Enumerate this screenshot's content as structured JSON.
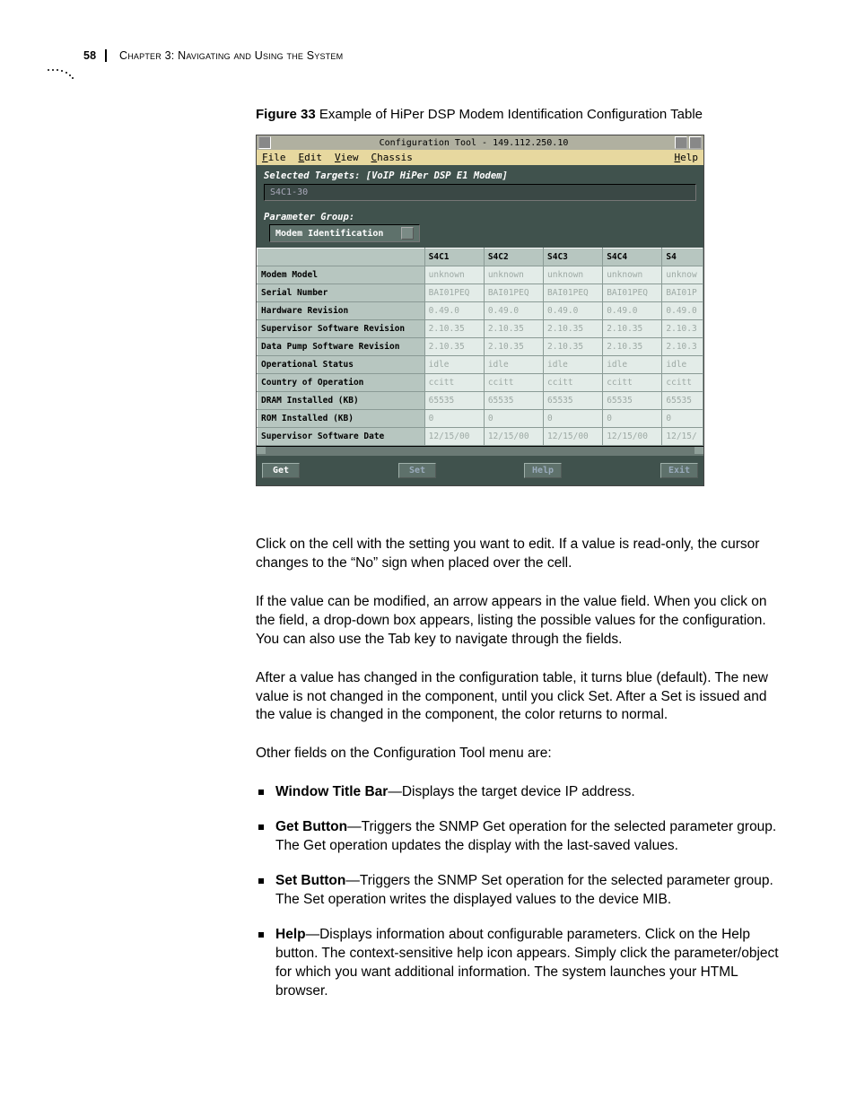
{
  "header": {
    "page_number": "58",
    "chapter_text": "Chapter 3: Navigating and Using the System"
  },
  "figure": {
    "label": "Figure 33",
    "caption": "  Example of HiPer DSP Modem Identification Configuration Table"
  },
  "window": {
    "title": "Configuration Tool - 149.112.250.10",
    "menu": {
      "file": "File",
      "edit": "Edit",
      "view": "View",
      "chassis": "Chassis",
      "help": "Help"
    },
    "selected_targets_label": "Selected Targets:  [VoIP HiPer DSP E1 Modem]",
    "target_value": "S4C1-30",
    "param_group_label": "Parameter Group:",
    "param_group_value": "Modem Identification",
    "columns": [
      "S4C1",
      "S4C2",
      "S4C3",
      "S4C4",
      "S4"
    ],
    "rows": [
      {
        "label": "Modem Model",
        "vals": [
          "unknown",
          "unknown",
          "unknown",
          "unknown",
          "unknow"
        ]
      },
      {
        "label": "Serial Number",
        "vals": [
          "BAI01PEQ",
          "BAI01PEQ",
          "BAI01PEQ",
          "BAI01PEQ",
          "BAI01P"
        ]
      },
      {
        "label": "Hardware Revision",
        "vals": [
          "0.49.0",
          "0.49.0",
          "0.49.0",
          "0.49.0",
          "0.49.0"
        ]
      },
      {
        "label": "Supervisor Software Revision",
        "vals": [
          "2.10.35",
          "2.10.35",
          "2.10.35",
          "2.10.35",
          "2.10.3"
        ]
      },
      {
        "label": "Data Pump Software Revision",
        "vals": [
          "2.10.35",
          "2.10.35",
          "2.10.35",
          "2.10.35",
          "2.10.3"
        ]
      },
      {
        "label": "Operational Status",
        "vals": [
          "idle",
          "idle",
          "idle",
          "idle",
          "idle"
        ]
      },
      {
        "label": "Country of Operation",
        "vals": [
          "ccitt",
          "ccitt",
          "ccitt",
          "ccitt",
          "ccitt"
        ]
      },
      {
        "label": "DRAM Installed (KB)",
        "vals": [
          "65535",
          "65535",
          "65535",
          "65535",
          "65535"
        ]
      },
      {
        "label": "ROM Installed (KB)",
        "vals": [
          "0",
          "0",
          "0",
          "0",
          "0"
        ]
      },
      {
        "label": "Supervisor Software Date",
        "vals": [
          "12/15/00",
          "12/15/00",
          "12/15/00",
          "12/15/00",
          "12/15/"
        ]
      }
    ],
    "buttons": {
      "get": "Get",
      "set": "Set",
      "help": "Help",
      "exit": "Exit"
    }
  },
  "body": {
    "p1": "Click on the cell with the setting you want to edit. If a value is read-only, the cursor changes to the “No” sign when placed over the cell.",
    "p2": "If the value can be modified, an arrow appears in the value field. When you click on the field, a drop-down box appears, listing the possible values for the configuration. You can also use the Tab key to navigate through the fields.",
    "p3": "After a value has changed in the configuration table, it turns blue (default). The new value is not changed in the component, until you click Set. After a Set is issued and the value is changed in the component, the color returns to normal.",
    "p4": "Other fields on the Configuration Tool menu are:",
    "bullets": [
      {
        "term": "Window Title Bar",
        "rest": "—Displays the target device IP address."
      },
      {
        "term": "Get Button",
        "rest": "—Triggers the SNMP Get operation for the selected parameter group. The Get operation updates the display with the last-saved values."
      },
      {
        "term": "Set Button",
        "rest": "—Triggers the SNMP Set operation for the selected parameter group. The Set operation writes the displayed values to the device MIB."
      },
      {
        "term": "Help",
        "rest": "—Displays information about configurable parameters. Click on the Help button. The context-sensitive help icon appears. Simply click the parameter/object for which you want additional information. The system launches your HTML browser."
      }
    ]
  }
}
